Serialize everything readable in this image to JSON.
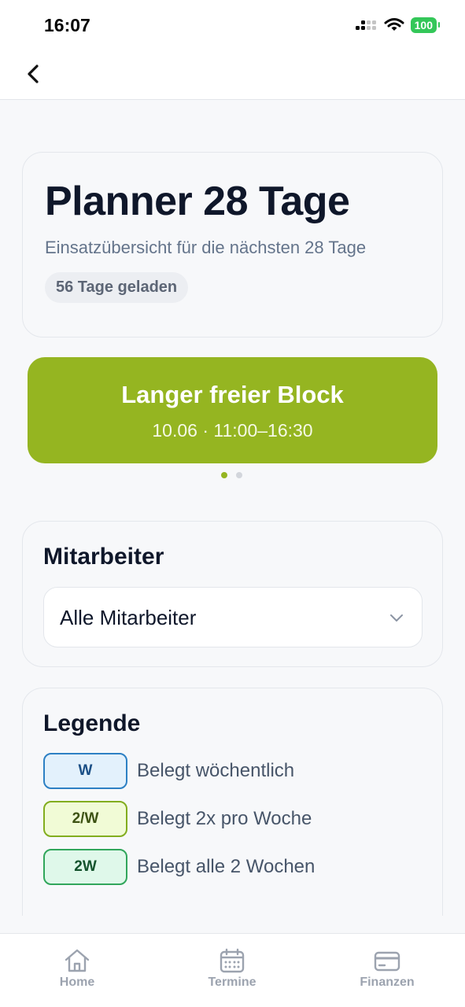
{
  "status_bar": {
    "time": "16:07",
    "battery": "100"
  },
  "header": {
    "title": "Planner 28 Tage",
    "subtitle": "Einsatzübersicht für die nächsten 28 Tage",
    "badge": "56 Tage geladen"
  },
  "hero": {
    "title": "Langer freier Block",
    "detail": "10.06 · 11:00–16:30",
    "color": "#95b521",
    "pager": {
      "total": 2,
      "active": 1
    }
  },
  "employee_filter": {
    "title": "Mitarbeiter",
    "selected": "Alle Mitarbeiter"
  },
  "legend": {
    "title": "Legende",
    "items": [
      {
        "code": "W",
        "label": "Belegt wöchentlich",
        "color": "#2d80c4"
      },
      {
        "code": "2/W",
        "label": "Belegt 2x pro Woche",
        "color": "#82ad1e"
      },
      {
        "code": "2W",
        "label": "Belegt alle 2 Wochen",
        "color": "#31a65b"
      }
    ]
  },
  "tab_bar": {
    "items": [
      {
        "label": "Home",
        "icon": "home-icon"
      },
      {
        "label": "Termine",
        "icon": "calendar-icon"
      },
      {
        "label": "Finanzen",
        "icon": "card-icon"
      }
    ]
  }
}
